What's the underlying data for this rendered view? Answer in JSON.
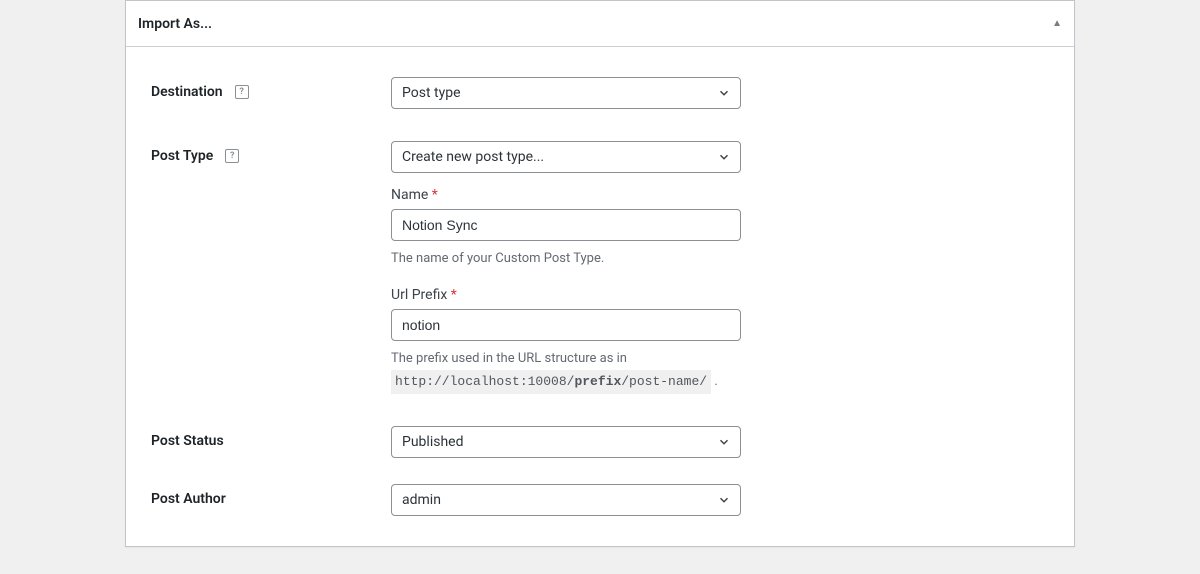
{
  "panel": {
    "title": "Import As..."
  },
  "fields": {
    "destination": {
      "label": "Destination",
      "value": "Post type"
    },
    "post_type": {
      "label": "Post Type",
      "value": "Create new post type...",
      "name_label": "Name",
      "name_value": "Notion Sync",
      "name_help": "The name of your Custom Post Type.",
      "url_prefix_label": "Url Prefix",
      "url_prefix_value": "notion",
      "url_prefix_help_pre": "The prefix used in the URL structure as in",
      "url_example_pre": "http://localhost:10008/",
      "url_example_bold": "prefix",
      "url_example_post": "/post-name/",
      "url_prefix_help_post": "."
    },
    "post_status": {
      "label": "Post Status",
      "value": "Published"
    },
    "post_author": {
      "label": "Post Author",
      "value": "admin"
    }
  },
  "required_marker": "*",
  "help_icon_text": "?"
}
